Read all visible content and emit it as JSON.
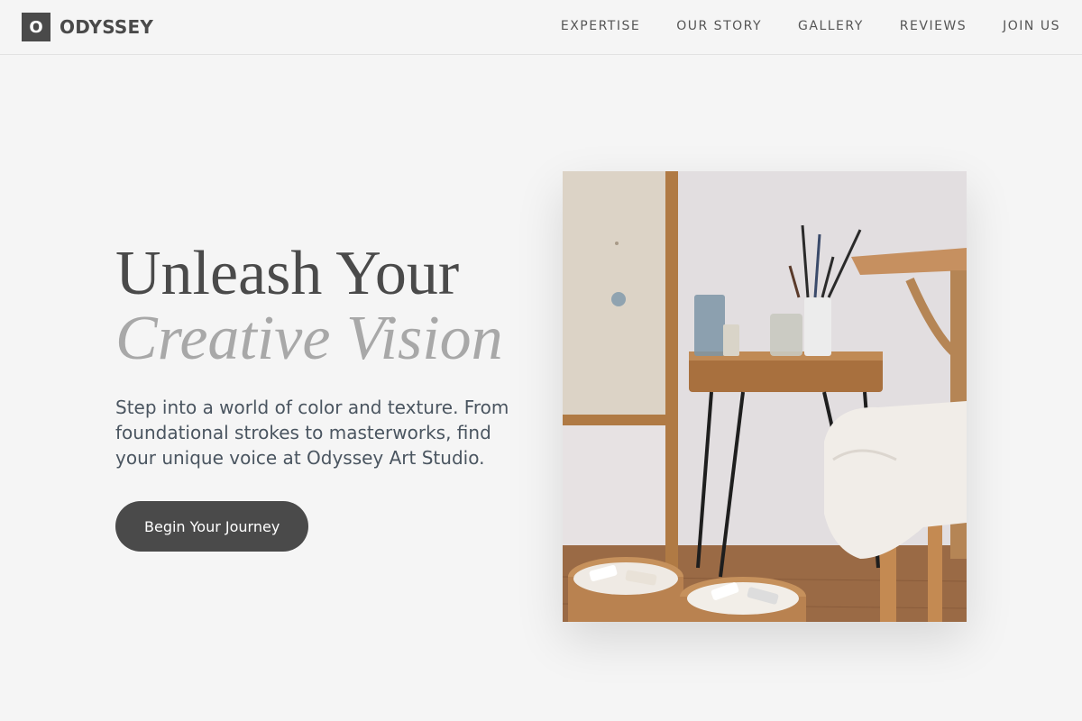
{
  "brand": {
    "mark": "O",
    "name": "ODYSSEY"
  },
  "nav": {
    "items": [
      {
        "label": "EXPERTISE"
      },
      {
        "label": "OUR STORY"
      },
      {
        "label": "GALLERY"
      },
      {
        "label": "REVIEWS"
      },
      {
        "label": "JOIN US"
      }
    ]
  },
  "hero": {
    "headline_line1": "Unleash Your",
    "headline_line2": "Creative Vision",
    "body": "Step into a world of color and texture. From foundational strokes to masterworks, find your unique voice at Odyssey Art Studio.",
    "cta_label": "Begin Your Journey"
  },
  "colors": {
    "background": "#f5f5f5",
    "primary": "#4a4a4a",
    "muted_headline": "#a8a8a8"
  }
}
